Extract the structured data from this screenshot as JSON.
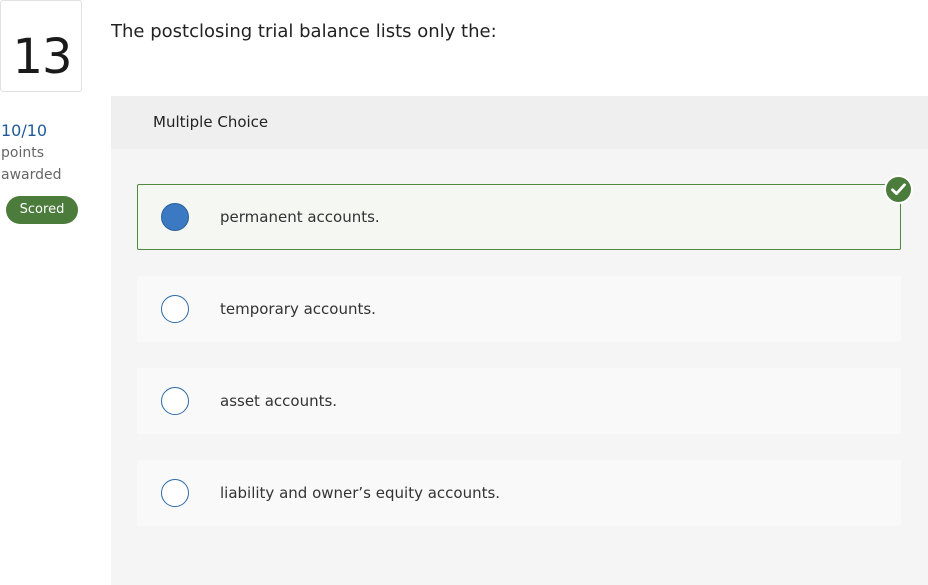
{
  "question": {
    "number": "13",
    "text": "The postclosing trial balance lists only the:"
  },
  "scoring": {
    "points": "10/10",
    "points_label": "points",
    "awarded_label": "awarded",
    "status_badge": "Scored"
  },
  "answer_panel": {
    "title": "Multiple Choice",
    "options": [
      {
        "label": "permanent accounts.",
        "selected": true,
        "correct": true
      },
      {
        "label": "temporary accounts.",
        "selected": false,
        "correct": false
      },
      {
        "label": "asset accounts.",
        "selected": false,
        "correct": false
      },
      {
        "label": "liability and owner’s equity accounts.",
        "selected": false,
        "correct": false
      }
    ]
  },
  "icons": {
    "correct_indicator": "check-circle-icon"
  },
  "colors": {
    "accent_blue": "#3b7ac2",
    "success_green": "#4b7c3c",
    "score_text": "#1f5a99"
  }
}
